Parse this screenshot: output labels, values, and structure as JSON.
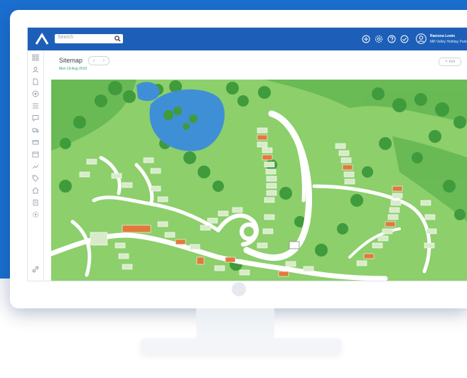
{
  "search": {
    "placeholder": "Search"
  },
  "topbar": {
    "icons": [
      "add-circle-icon",
      "gear-icon",
      "help-icon",
      "check-circle-icon"
    ],
    "user": {
      "name": "Ramona Lewis",
      "subtitle": "Mill Valley Holiday Park"
    }
  },
  "sidebar": {
    "icons": [
      "grid-icon",
      "user-icon",
      "document-icon",
      "target-icon",
      "list-icon",
      "chat-icon",
      "truck-icon",
      "card-icon",
      "calendar-icon",
      "chart-icon",
      "tag-icon",
      "home-icon",
      "clipboard-icon",
      "settings-icon",
      "link-icon"
    ]
  },
  "page": {
    "title": "Sitemap",
    "date": "Mon 19 Aug 2019",
    "prev_label": "‹",
    "next_label": "›",
    "edit_label": "✎ Edit"
  },
  "colors": {
    "brand_blue": "#1b6fcf",
    "topbar": "#1d5fb8",
    "map_grass": "#8ccf6b",
    "map_tree": "#3f9b3c",
    "lake": "#3f8fd6",
    "plot_occupied": "#e07a3a",
    "plot_free": "#d8ebc9",
    "status_green": "#2aa36a"
  }
}
